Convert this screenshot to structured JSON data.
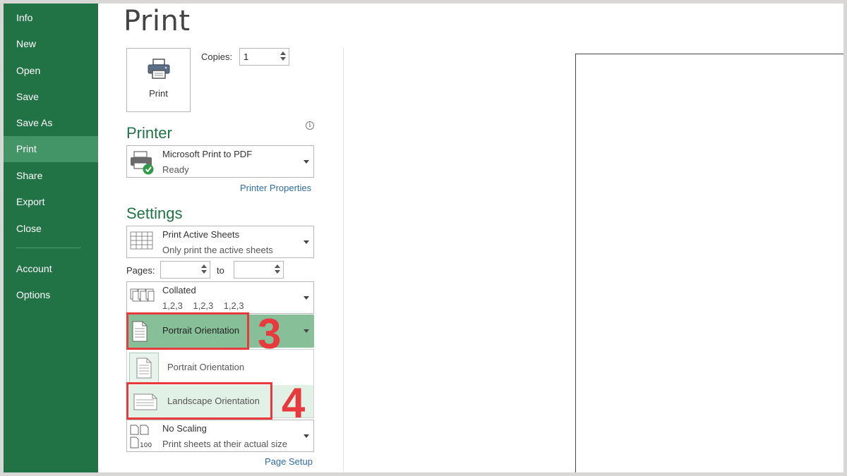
{
  "nav": {
    "items": [
      {
        "label": "Info"
      },
      {
        "label": "New"
      },
      {
        "label": "Open"
      },
      {
        "label": "Save"
      },
      {
        "label": "Save As"
      },
      {
        "label": "Print"
      },
      {
        "label": "Share"
      },
      {
        "label": "Export"
      },
      {
        "label": "Close"
      },
      {
        "label": "Account"
      },
      {
        "label": "Options"
      }
    ],
    "active": "Print"
  },
  "page_title": "Print",
  "print_button": {
    "label": "Print",
    "icon": "printer-icon"
  },
  "copies": {
    "label": "Copies:",
    "value": "1"
  },
  "printer": {
    "section_title": "Printer",
    "info_icon": "info-icon",
    "name": "Microsoft Print to PDF",
    "status": "Ready",
    "properties_link": "Printer Properties"
  },
  "settings": {
    "section_title": "Settings",
    "print_what": {
      "title": "Print Active Sheets",
      "subtitle": "Only print the active sheets"
    },
    "pages": {
      "label": "Pages:",
      "to_label": "to",
      "from_value": "",
      "to_value": ""
    },
    "collation": {
      "title": "Collated",
      "subtitle": "1,2,3    1,2,3    1,2,3"
    },
    "orientation": {
      "selected": "Portrait Orientation",
      "options": [
        "Portrait Orientation",
        "Landscape Orientation"
      ]
    },
    "scaling": {
      "title": "No Scaling",
      "subtitle": "Print sheets at their actual size",
      "icon_text": "100"
    },
    "page_setup_link": "Page Setup"
  },
  "annotations": {
    "step3": "3",
    "step4": "4",
    "color": "#e8393d"
  },
  "colors": {
    "sidebar": "#217346",
    "active_nav": "#439467",
    "accent": "#217346",
    "selected_dropdown": "#86bf98",
    "link": "#2e6da4"
  }
}
